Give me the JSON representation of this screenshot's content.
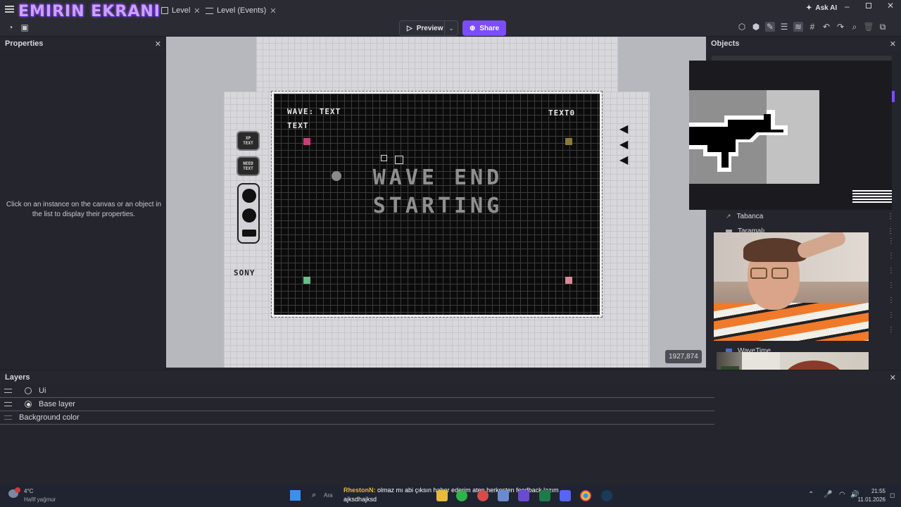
{
  "overlay": {
    "stream_title": "EMIRIN EKRANI"
  },
  "tabs": [
    {
      "label": "Level"
    },
    {
      "label": "Level (Events)"
    }
  ],
  "titlebar": {
    "ask_ai": "Ask AI"
  },
  "toolbar": {
    "preview_label": "Preview",
    "share_label": "Share"
  },
  "properties": {
    "title": "Properties",
    "empty_message": "Click on an instance on the canvas or an object in the list to display their properties."
  },
  "objects": {
    "title": "Objects",
    "items": [
      {
        "label": "Tabanca"
      },
      {
        "label": "Taramalı"
      },
      {
        "label": "WaveTime"
      }
    ]
  },
  "canvas": {
    "coords": "1927,874",
    "wave_label": "WAVE: TEXT",
    "text_left": "TEXT",
    "text_right": "TEXT0",
    "center_line1": "WAVE END",
    "center_line2": "STARTING",
    "xp_text": "XP TEXT",
    "need_text": "NEED TEXT",
    "sony": "SONY"
  },
  "layers": {
    "title": "Layers",
    "items": [
      {
        "label": "Ui"
      },
      {
        "label": "Base layer"
      },
      {
        "label": "Background color"
      }
    ]
  },
  "taskbar": {
    "weather_temp": "4°C",
    "weather_desc": "Hafif yağmur",
    "search_label": "Ara",
    "chat_user": "RhestonN:",
    "chat_message": "olmaz mı abi çıksın haber ederim aten herkesten feedback lazım",
    "chat_line2": "ajksdhajksd",
    "time": "21:55",
    "date": "11.01.2026"
  },
  "colors": {
    "accent": "#7b4dff",
    "canvas_bg": "#b7b7be",
    "panel_bg": "#25252d"
  }
}
